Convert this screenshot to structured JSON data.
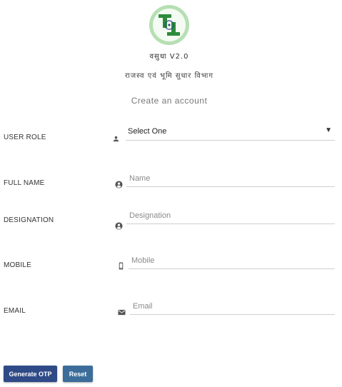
{
  "header": {
    "app_title": "वसुधा V2.0",
    "department": "राजस्व एवं भूमि सुधार विभाग",
    "subtitle": "Create an account"
  },
  "form": {
    "user_role": {
      "label": "USER ROLE",
      "value": "Select One",
      "icon": "person-icon"
    },
    "full_name": {
      "label": "FULL NAME",
      "placeholder": "Name",
      "icon": "account-circle-icon"
    },
    "designation": {
      "label": "DESIGNATION",
      "placeholder": "Designation",
      "icon": "account-circle-icon"
    },
    "mobile": {
      "label": "MOBILE",
      "placeholder": "Mobile",
      "icon": "phone-icon"
    },
    "email": {
      "label": "EMAIL",
      "placeholder": "Email",
      "icon": "mail-icon"
    }
  },
  "buttons": {
    "generate_otp": "Generate OTP",
    "reset": "Reset"
  },
  "colors": {
    "primary_button": "#2e4a87",
    "secondary_button": "#3c6d9a",
    "logo_green": "#2e8b3a"
  }
}
